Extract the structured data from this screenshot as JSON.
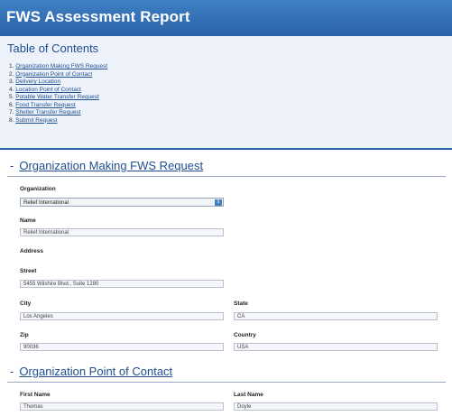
{
  "header": {
    "title": "FWS Assessment Report"
  },
  "toc": {
    "title": "Table of Contents",
    "items": [
      {
        "num": "1.",
        "label": "Organization Making FWS Request"
      },
      {
        "num": "2.",
        "label": "Organization Point of Contact"
      },
      {
        "num": "3.",
        "label": "Delivery Location"
      },
      {
        "num": "4.",
        "label": "Location Point of Contact"
      },
      {
        "num": "5.",
        "label": "Potable Water Transfer Request"
      },
      {
        "num": "6.",
        "label": "Food Transfer Request"
      },
      {
        "num": "7.",
        "label": "Shelter Transfer Request"
      },
      {
        "num": "8.",
        "label": "Submit Request"
      }
    ]
  },
  "section1": {
    "dash": "-",
    "title": "Organization Making FWS Request",
    "organization_label": "Organization",
    "organization_value": "Relief International",
    "name_label": "Name",
    "name_value": "Relief International",
    "address_label": "Address",
    "street_label": "Street",
    "street_value": "5455 Wilshire Blvd., Suite 1280",
    "city_label": "City",
    "city_value": "Los Angeles",
    "state_label": "State",
    "state_value": "CA",
    "zip_label": "Zip",
    "zip_value": "90036",
    "country_label": "Country",
    "country_value": "USA"
  },
  "section2": {
    "dash": "-",
    "title": "Organization Point of Contact",
    "first_name_label": "First Name",
    "first_name_value": "Thomas",
    "last_name_label": "Last Name",
    "last_name_value": "Doyle"
  }
}
